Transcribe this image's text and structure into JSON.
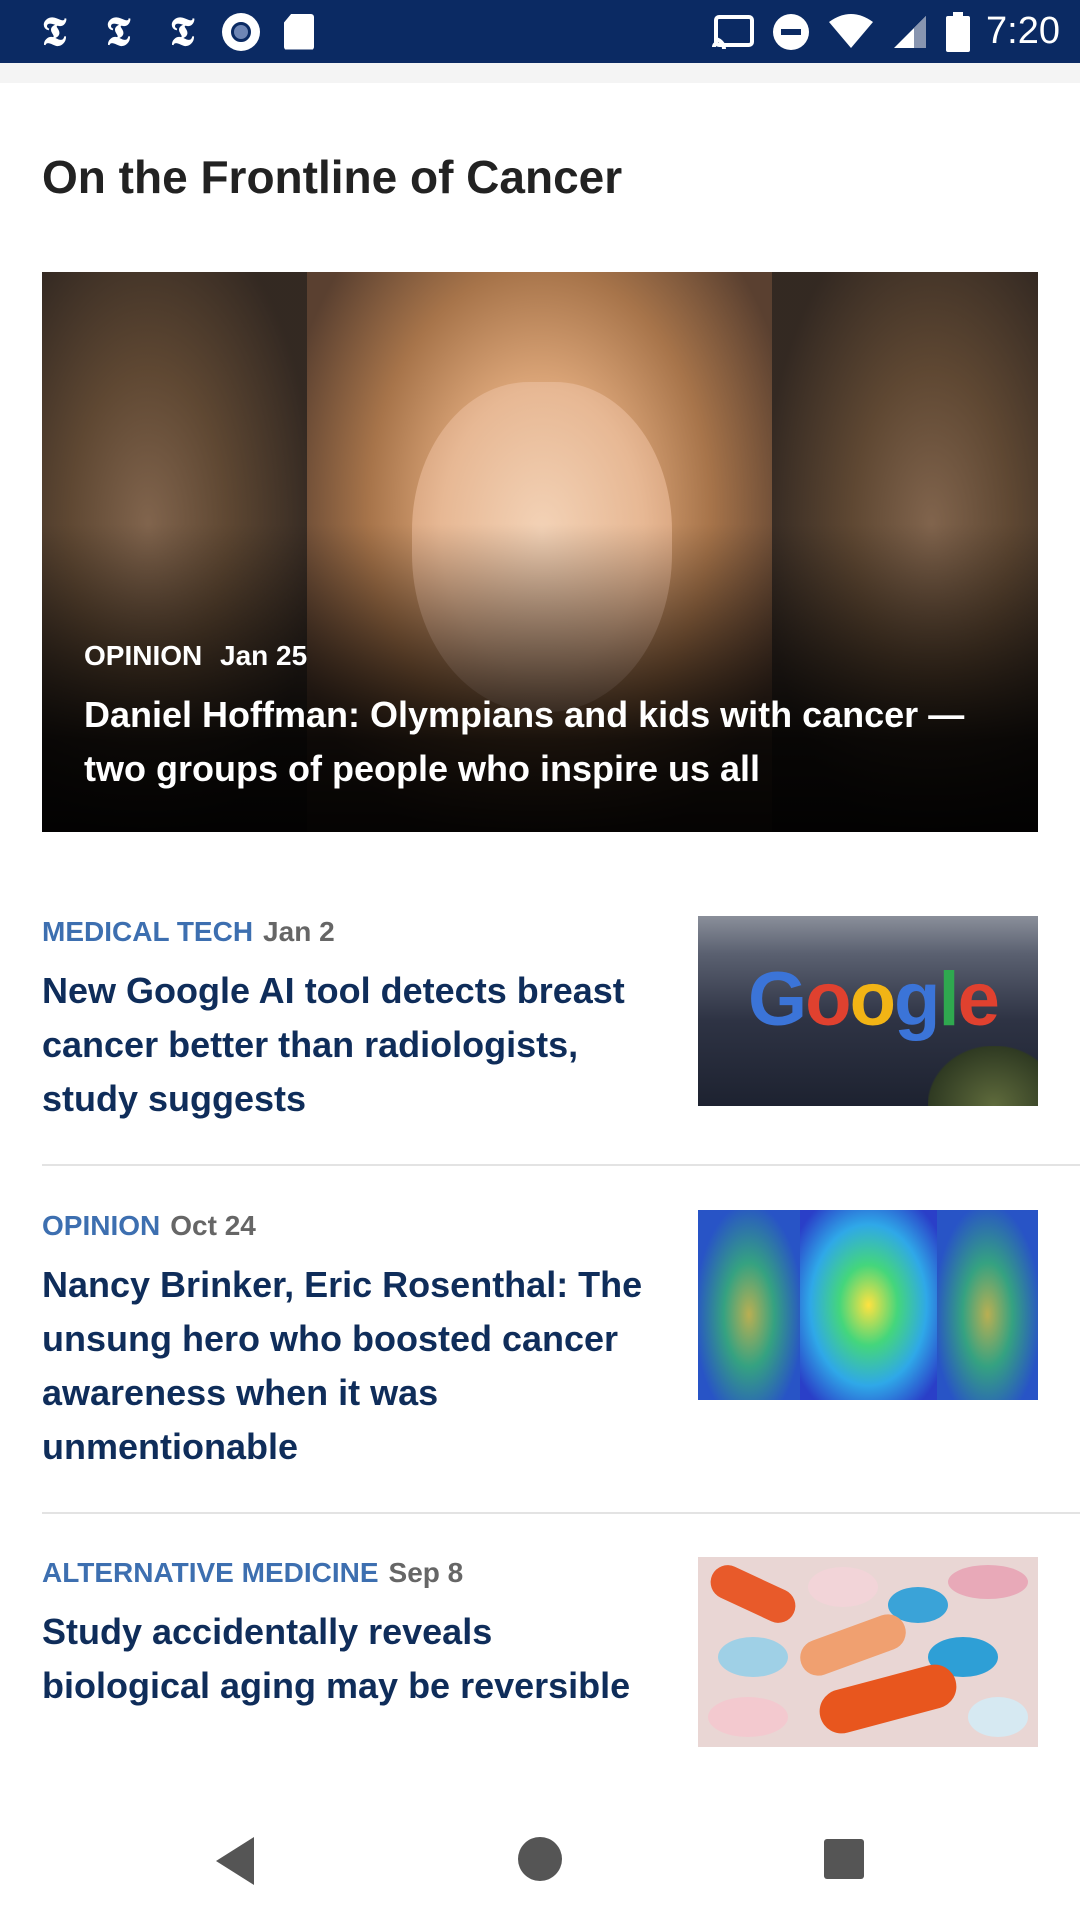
{
  "status_bar": {
    "time": "7:20",
    "left_icons": [
      "nyt-icon",
      "nyt-icon",
      "nyt-icon",
      "record-icon",
      "sd-card-icon"
    ],
    "right_icons": [
      "cast-icon",
      "do-not-disturb-icon",
      "wifi-icon",
      "signal-icon",
      "battery-icon"
    ]
  },
  "section": {
    "title": "On the Frontline of Cancer"
  },
  "hero": {
    "category": "OPINION",
    "date": "Jan 25",
    "headline": "Daniel Hoffman: Olympians and kids with cancer — two groups of people who inspire us all"
  },
  "articles": [
    {
      "category": "MEDICAL TECH",
      "date": "Jan 2",
      "headline": "New Google AI tool detects breast cancer better than radiologists, study suggests",
      "thumb_text": "Google"
    },
    {
      "category": "OPINION",
      "date": "Oct 24",
      "headline": "Nancy Brinker, Eric Rosenthal: The unsung hero who boosted cancer awareness when it was unmentionable"
    },
    {
      "category": "ALTERNATIVE MEDICINE",
      "date": "Sep 8",
      "headline": "Study accidentally reveals biological aging may be reversible"
    }
  ],
  "colors": {
    "status_bar": "#0b2a63",
    "category": "#3d6fb0",
    "headline": "#0f2d5a"
  },
  "nav_bar": {
    "icons": [
      "back-icon",
      "home-icon",
      "recents-icon"
    ]
  }
}
